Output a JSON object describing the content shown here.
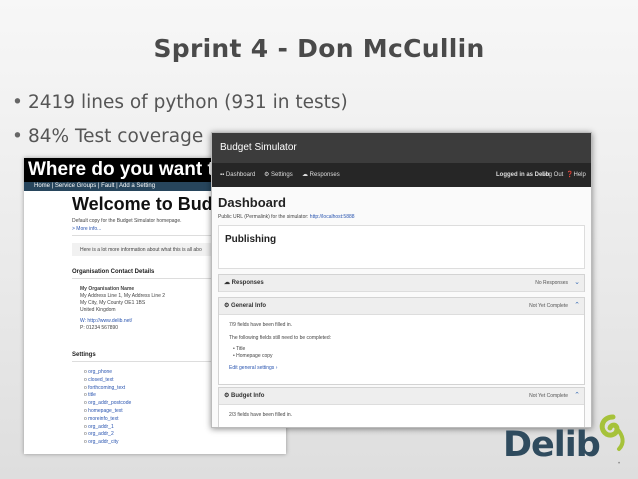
{
  "slide": {
    "title": "Sprint 4 - Don McCullin",
    "bullets": [
      "2419 lines of python (931 in tests)",
      "84% Test coverage"
    ],
    "bullet_char": "•",
    "slide_number": "•"
  },
  "back_screenshot": {
    "header": "Where do you want to spen",
    "nav": "Home | Service Groups | Fault | Add a Setting",
    "heading": "Welcome to Budget",
    "intro": "Default copy for the Budget Simulator homepage.",
    "more_link": "> More info...",
    "more_text": "Here is a lot more information about what this is all abo",
    "contact_heading": "Organisation Contact Details",
    "org_lines": [
      "My Organisation Name",
      "My Address Line 1, My Address Line 2",
      "My City, My County OE1 1BS",
      "United Kingdom"
    ],
    "web": "W: http://www.delib.net/",
    "phone": "P: 01234 567890",
    "settings_heading": "Settings",
    "settings": [
      "org_phone",
      "closed_text",
      "forthcoming_text",
      "title",
      "org_addr_postcode",
      "homepage_text",
      "moreinfo_text",
      "org_addr_1",
      "org_addr_2",
      "org_addr_city"
    ]
  },
  "front_screenshot": {
    "app_title": "Budget Simulator",
    "nav": {
      "dashboard": "Dashboard",
      "settings": "Settings",
      "responses": "Responses",
      "logged_in": "Logged in as Delib",
      "logout": "Log Out",
      "help": "Help"
    },
    "page_title": "Dashboard",
    "public_url_label": "Public URL (Permalink) for the simulator:",
    "public_url": "http://localhost:5888",
    "publishing": "Publishing",
    "panels": [
      {
        "title": "Responses",
        "status": "No Responses",
        "expanded": false
      },
      {
        "title": "General Info",
        "status": "Not Yet Complete",
        "expanded": true,
        "lines": [
          "7/9 fields have been filled in.",
          "The following fields still need to be completed:"
        ],
        "items": [
          "Title",
          "Homepage copy"
        ],
        "link": "Edit general settings ›"
      },
      {
        "title": "Budget Info",
        "status": "Not Yet Complete",
        "expanded": true,
        "lines": [
          "2/3 fields have been filled in."
        ]
      }
    ]
  },
  "logo": {
    "text": "Delib",
    "colors": {
      "text": "#2f4b5e",
      "swirl": "#a6c23a"
    }
  },
  "colors": {
    "title": "#4a4a4a",
    "dark_header": "#3c3c3c",
    "dark_nav": "#262626",
    "link": "#2a55b0"
  }
}
